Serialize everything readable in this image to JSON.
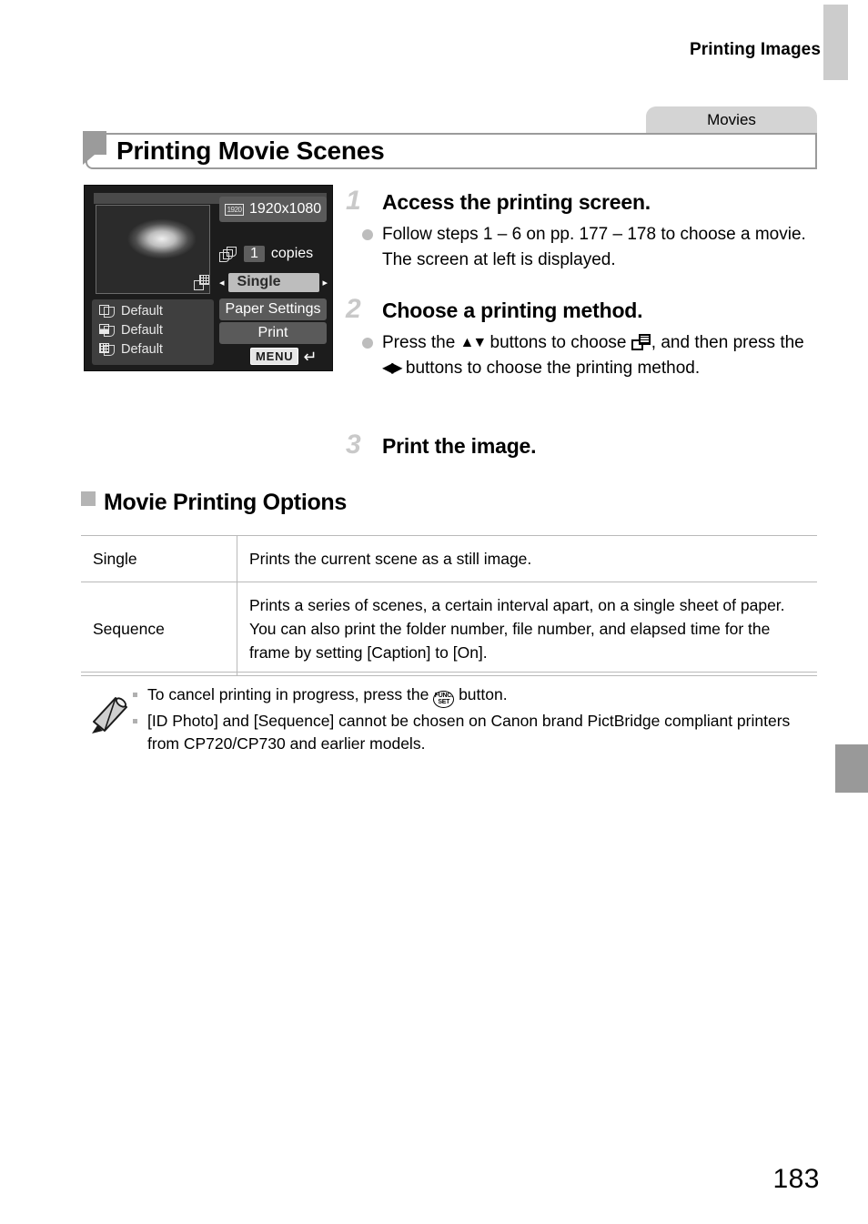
{
  "page": {
    "running_header": "Printing Images",
    "page_number": "183",
    "section_tab": "Movies",
    "title": "Printing Movie Scenes"
  },
  "camera_screen": {
    "resolution_badge": "1920",
    "resolution": "1920x1080",
    "copies_count": "1",
    "copies_label": "copies",
    "print_method": "Single",
    "arrow_left": "◂",
    "arrow_right": "▸",
    "paper_settings_button": "Paper Settings",
    "print_button": "Print",
    "menu_button": "MENU",
    "menu_back_arrow": "↵",
    "defaults": [
      {
        "label": "Default",
        "icon": "paper-size-icon"
      },
      {
        "label": "Default",
        "icon": "paper-type-icon"
      },
      {
        "label": "Default",
        "icon": "page-layout-icon"
      }
    ]
  },
  "steps": [
    {
      "number": "1",
      "title": "Access the printing screen.",
      "body_before": "Follow steps 1 – 6 on pp. 177 – 178 to choose a movie. The screen at left is displayed."
    },
    {
      "number": "2",
      "title": "Choose a printing method.",
      "body_1": "Press the ",
      "nav_updown": "▲▼",
      "body_2": " buttons to choose ",
      "body_3": ", and then press the ",
      "nav_leftright": "◀▶",
      "body_4": " buttons to choose the printing method."
    },
    {
      "number": "3",
      "title": "Print the image.",
      "body": ""
    }
  ],
  "subheading": "Movie Printing Options",
  "options_table": {
    "rows": [
      {
        "name": "Single",
        "description": "Prints the current scene as a still image."
      },
      {
        "name": "Sequence",
        "description": "Prints a series of scenes, a certain interval apart, on a single sheet of paper. You can also print the folder number, file number, and elapsed time for the frame by setting [Caption] to [On]."
      }
    ]
  },
  "notes": {
    "item1_before": "To cancel printing in progress, press the ",
    "func_set_line1": "FUNC.",
    "func_set_line2": "SET",
    "item1_after": " button.",
    "item2": "[ID Photo] and [Sequence] cannot be chosen on Canon brand PictBridge compliant printers from CP720/CP730 and earlier models."
  },
  "colors": {
    "tab_light": "#cccccc",
    "tab_dark": "#999999",
    "section_tab": "#d4d4d4",
    "rule": "#b9b9b9",
    "step_number": "#c9c9c9",
    "bullet": "#bdbdbd"
  }
}
